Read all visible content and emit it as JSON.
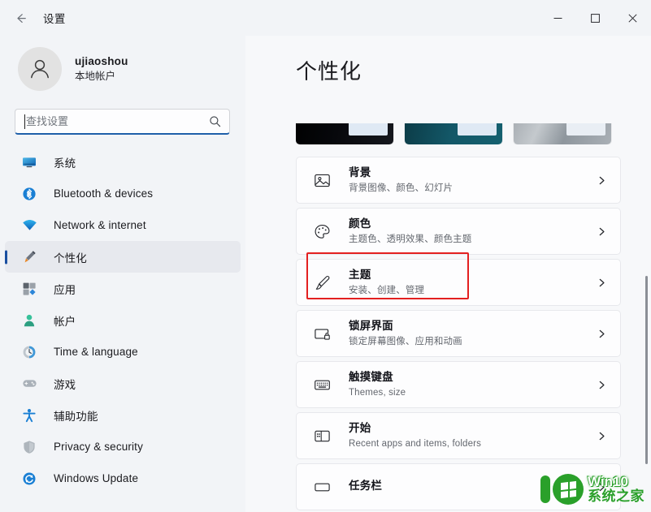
{
  "window": {
    "title": "设置",
    "back_icon": "back-arrow-icon",
    "controls": {
      "minimize": "minimize-icon",
      "maximize": "maximize-icon",
      "close": "close-icon"
    }
  },
  "account": {
    "name": "ujiaoshou",
    "type": "本地帐户",
    "avatar_icon": "user-avatar-icon"
  },
  "search": {
    "placeholder": "查找设置",
    "value": "",
    "icon": "search-icon",
    "focused": true,
    "accent_color": "#1f5fa9"
  },
  "sidebar": {
    "items": [
      {
        "label": "系统",
        "icon": "system-monitor-icon",
        "selected": false
      },
      {
        "label": "Bluetooth & devices",
        "icon": "bluetooth-icon",
        "selected": false
      },
      {
        "label": "Network & internet",
        "icon": "wifi-icon",
        "selected": false
      },
      {
        "label": "个性化",
        "icon": "personalization-brush-icon",
        "selected": true
      },
      {
        "label": "应用",
        "icon": "apps-icon",
        "selected": false
      },
      {
        "label": "帐户",
        "icon": "accounts-person-icon",
        "selected": false
      },
      {
        "label": "Time & language",
        "icon": "clock-globe-icon",
        "selected": false
      },
      {
        "label": "游戏",
        "icon": "gamepad-icon",
        "selected": false
      },
      {
        "label": "辅助功能",
        "icon": "accessibility-icon",
        "selected": false
      },
      {
        "label": "Privacy & security",
        "icon": "shield-icon",
        "selected": false
      },
      {
        "label": "Windows Update",
        "icon": "update-refresh-icon",
        "selected": false
      }
    ],
    "selected_indicator_color": "#1a4fa0"
  },
  "main": {
    "page_title": "个性化",
    "theme_previews": [
      {
        "name": "theme-preview-dark"
      },
      {
        "name": "theme-preview-teal"
      },
      {
        "name": "theme-preview-light"
      }
    ],
    "cards": [
      {
        "title": "背景",
        "subtitle": "背景图像、颜色、幻灯片",
        "icon": "picture-icon",
        "chevron": "chevron-right-icon",
        "highlighted": false
      },
      {
        "title": "颜色",
        "subtitle": "主题色、透明效果、颜色主题",
        "icon": "palette-icon",
        "chevron": "chevron-right-icon",
        "highlighted": false
      },
      {
        "title": "主题",
        "subtitle": "安装、创建、管理",
        "icon": "paintbrush-icon",
        "chevron": "chevron-right-icon",
        "highlighted": true
      },
      {
        "title": "锁屏界面",
        "subtitle": "锁定屏幕图像、应用和动画",
        "icon": "lock-screen-icon",
        "chevron": "chevron-right-icon",
        "highlighted": false
      },
      {
        "title": "触摸键盘",
        "subtitle": "Themes, size",
        "icon": "keyboard-icon",
        "chevron": "chevron-right-icon",
        "highlighted": false
      },
      {
        "title": "开始",
        "subtitle": "Recent apps and items, folders",
        "icon": "start-menu-icon",
        "chevron": "chevron-right-icon",
        "highlighted": false
      },
      {
        "title": "任务栏",
        "subtitle": "",
        "icon": "taskbar-icon",
        "chevron": "chevron-right-icon",
        "highlighted": false
      }
    ],
    "highlight_color": "#e32020"
  },
  "watermark": {
    "line1": "Win10",
    "line2": "系统之家",
    "color": "#2aa02a"
  }
}
